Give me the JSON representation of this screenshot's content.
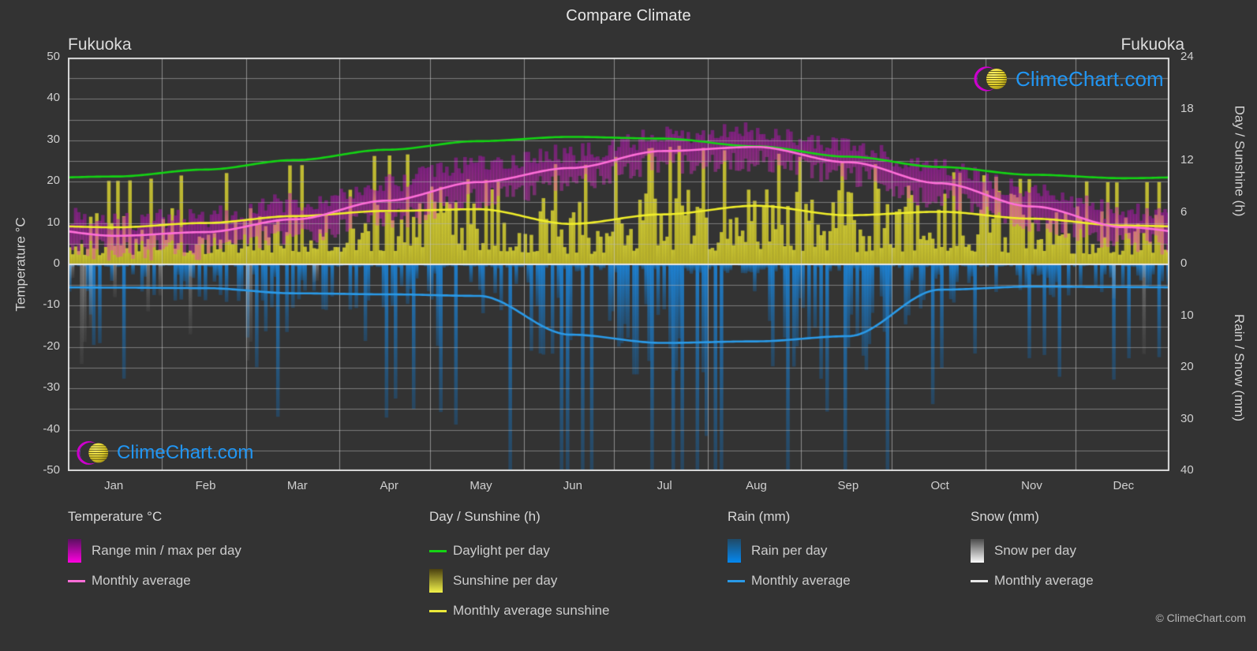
{
  "header": {
    "title": "Compare Climate",
    "location_left": "Fukuoka",
    "location_right": "Fukuoka"
  },
  "axes": {
    "left_title": "Temperature °C",
    "right_title_top": "Day / Sunshine (h)",
    "right_title_bottom": "Rain / Snow (mm)",
    "left_ticks": [
      "50",
      "40",
      "30",
      "20",
      "10",
      "0",
      "-10",
      "-20",
      "-30",
      "-40",
      "-50"
    ],
    "right_ticks_top": [
      "24",
      "18",
      "12",
      "6",
      "0"
    ],
    "right_ticks_bottom": [
      "10",
      "20",
      "30",
      "40"
    ],
    "x_ticks": [
      "Jan",
      "Feb",
      "Mar",
      "Apr",
      "May",
      "Jun",
      "Jul",
      "Aug",
      "Sep",
      "Oct",
      "Nov",
      "Dec"
    ]
  },
  "legend": {
    "groups": [
      {
        "title": "Temperature °C",
        "items": [
          {
            "label": "Range min / max per day",
            "swatch": "box",
            "color": "#ff00e0",
            "color2": "#5a1060"
          },
          {
            "label": "Monthly average",
            "swatch": "line",
            "color": "#ff6ed8"
          }
        ]
      },
      {
        "title": "Day / Sunshine (h)",
        "items": [
          {
            "label": "Daylight per day",
            "swatch": "line",
            "color": "#14d414"
          },
          {
            "label": "Sunshine per day",
            "swatch": "box",
            "color": "#f2f24a",
            "color2": "#4a4010"
          },
          {
            "label": "Monthly average sunshine",
            "swatch": "line",
            "color": "#ece93a"
          }
        ]
      },
      {
        "title": "Rain (mm)",
        "items": [
          {
            "label": "Rain per day",
            "swatch": "box",
            "color": "#0488f0",
            "color2": "#204a66"
          },
          {
            "label": "Monthly average",
            "swatch": "line",
            "color": "#2a9ae8"
          }
        ]
      },
      {
        "title": "Snow (mm)",
        "items": [
          {
            "label": "Snow per day",
            "swatch": "box",
            "color": "#fbfbfb",
            "color2": "#4a4a4a"
          },
          {
            "label": "Monthly average",
            "swatch": "line",
            "color": "#e8e8e8"
          }
        ]
      }
    ],
    "copyright": "© ClimeChart.com"
  },
  "branding": {
    "logo_text": "ClimeChart.com",
    "ring_color": "#cc00cc",
    "ball_color": "#e8d62e",
    "text_color": "#2196f3"
  },
  "colors": {
    "background": "#333333",
    "grid": "#9a9a9a",
    "axis": "#dadada",
    "text": "#d0d0d0",
    "daylight": "#14d414",
    "sunshine_bar": "#d9d23a",
    "sunshine_avg": "#f0ee2a",
    "temp_range": "#e21fd4",
    "temp_avg": "#ff6ed8",
    "rain_bar": "#1787e0",
    "rain_avg": "#2a9ae8",
    "snow_bar": "#e6e6e6",
    "snow_avg": "#e8e8e8"
  },
  "chart_data": {
    "type": "area",
    "title": "Compare Climate",
    "subtitle": "Fukuoka",
    "xlabel": "",
    "ylabel": "Temperature °C",
    "grid": true,
    "legend_position": "bottom",
    "x": [
      "Jan",
      "Feb",
      "Mar",
      "Apr",
      "May",
      "Jun",
      "Jul",
      "Aug",
      "Sep",
      "Oct",
      "Nov",
      "Dec"
    ],
    "left_axis": {
      "label": "Temperature °C",
      "ylim": [
        -50,
        50
      ],
      "ticks": [
        50,
        40,
        30,
        20,
        10,
        0,
        -10,
        -20,
        -30,
        -40,
        -50
      ]
    },
    "right_axis_top": {
      "label": "Day / Sunshine (h)",
      "ylim": [
        0,
        24
      ],
      "ticks": [
        24,
        18,
        12,
        6,
        0
      ]
    },
    "right_axis_bottom": {
      "label": "Rain / Snow (mm)",
      "ylim": [
        0,
        40
      ],
      "ticks": [
        0,
        10,
        20,
        30,
        40
      ]
    },
    "series": [
      {
        "name": "Daylight per day",
        "unit": "h",
        "axis": "right_top",
        "color": "#14d414",
        "values": [
          10.2,
          11.0,
          12.1,
          13.3,
          14.3,
          14.8,
          14.6,
          13.7,
          12.5,
          11.3,
          10.4,
          10.0
        ]
      },
      {
        "name": "Monthly average sunshine",
        "unit": "h",
        "axis": "right_top",
        "color": "#f0ee2a",
        "values": [
          4.3,
          4.8,
          5.6,
          6.2,
          6.4,
          4.7,
          5.8,
          6.8,
          5.7,
          6.1,
          5.3,
          4.5
        ]
      },
      {
        "name": "Monthly average temperature",
        "unit": "°C",
        "axis": "left",
        "color": "#ff6ed8",
        "values": [
          6.9,
          7.8,
          10.9,
          15.4,
          19.9,
          23.3,
          27.4,
          28.4,
          24.7,
          19.6,
          14.0,
          9.0
        ]
      },
      {
        "name": "Temperature range min / max per day",
        "unit": "°C",
        "axis": "left",
        "color": "#e21fd4",
        "min": [
          3.2,
          3.8,
          6.6,
          11.0,
          15.7,
          19.9,
          24.3,
          25.1,
          21.4,
          15.6,
          10.2,
          5.2
        ],
        "max": [
          10.2,
          11.5,
          14.9,
          19.7,
          24.1,
          26.7,
          30.8,
          32.1,
          28.2,
          23.3,
          17.7,
          12.6
        ]
      },
      {
        "name": "Monthly average rain",
        "unit": "mm",
        "axis": "right_bottom",
        "color": "#2a9ae8",
        "values": [
          4.5,
          4.6,
          5.6,
          5.8,
          6.1,
          13.6,
          15.2,
          14.9,
          13.9,
          4.9,
          4.3,
          4.4
        ]
      }
    ]
  }
}
